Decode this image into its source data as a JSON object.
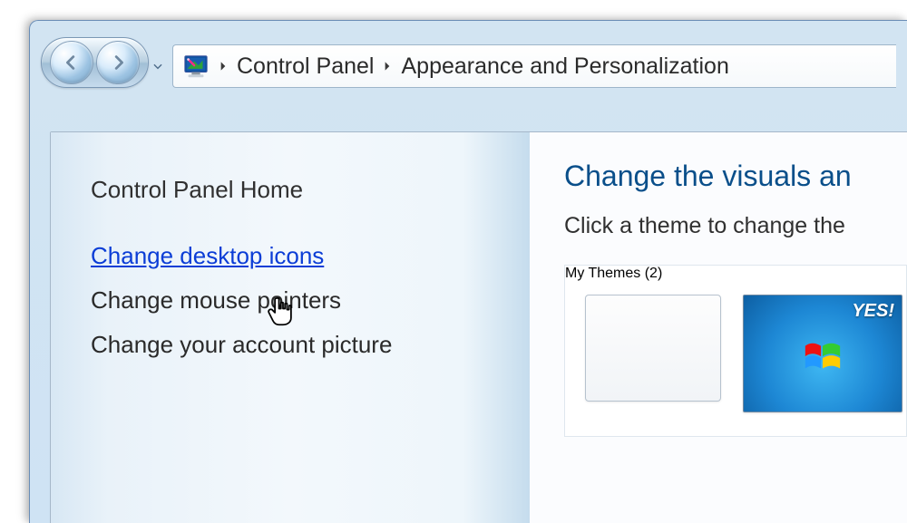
{
  "breadcrumb": {
    "item1": "Control Panel",
    "item2": "Appearance and Personalization"
  },
  "sidebar": {
    "home": "Control Panel Home",
    "links": [
      "Change desktop icons",
      "Change mouse pointers",
      "Change your account picture"
    ]
  },
  "main": {
    "title": "Change the visuals an",
    "subtitle": "Click a theme to change the ",
    "themes_header": "My Themes (2)",
    "thumb_badge": "YES!"
  }
}
